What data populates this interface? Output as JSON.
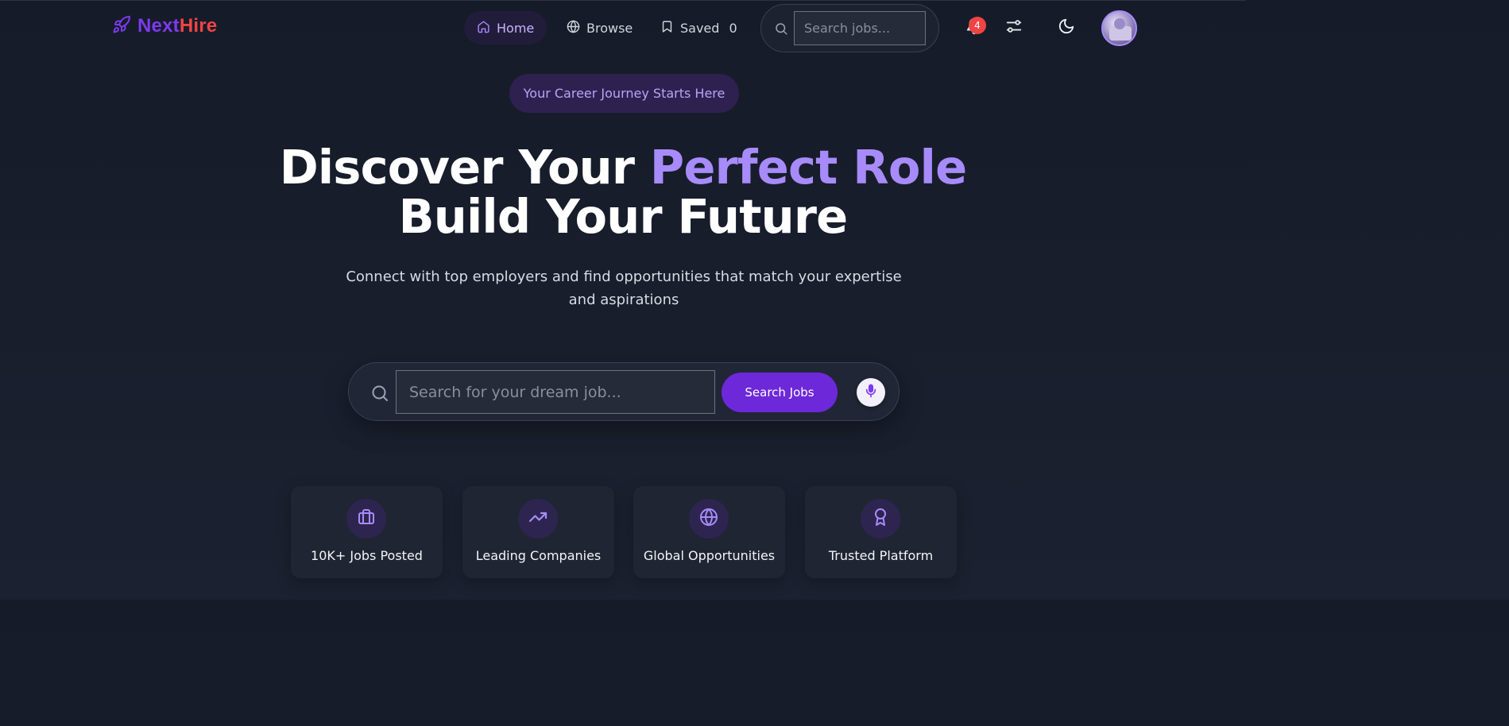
{
  "nav": {
    "logo_part1": "Next",
    "logo_part2": "Hire",
    "links": [
      {
        "label": "Home",
        "icon": "home-icon"
      },
      {
        "label": "Browse",
        "icon": "globe-icon"
      },
      {
        "label": "Saved",
        "icon": "bookmark-icon"
      }
    ],
    "saved_count": "0",
    "search_placeholder": "Search jobs...",
    "notification_count": "4"
  },
  "hero": {
    "pill": "Your Career Journey Starts Here",
    "title_part1": "Discover Your ",
    "title_accent": "Perfect Role",
    "title_line2": "Build Your Future",
    "subtitle": "Connect with top employers and find opportunities that match your expertise and aspirations",
    "search_placeholder": "Search for your dream job...",
    "search_button": "Search Jobs"
  },
  "features": [
    {
      "label": "10K+ Jobs Posted",
      "icon": "briefcase-icon"
    },
    {
      "label": "Leading Companies",
      "icon": "trending-up-icon"
    },
    {
      "label": "Global Opportunities",
      "icon": "globe-icon"
    },
    {
      "label": "Trusted Platform",
      "icon": "award-icon"
    }
  ],
  "colors": {
    "accent": "#a78bfa",
    "primary_button": "#6d28d9",
    "logo_next": "#7c3aed",
    "logo_hire": "#ef4444",
    "badge": "#ef4444",
    "background": "#181d2a"
  }
}
